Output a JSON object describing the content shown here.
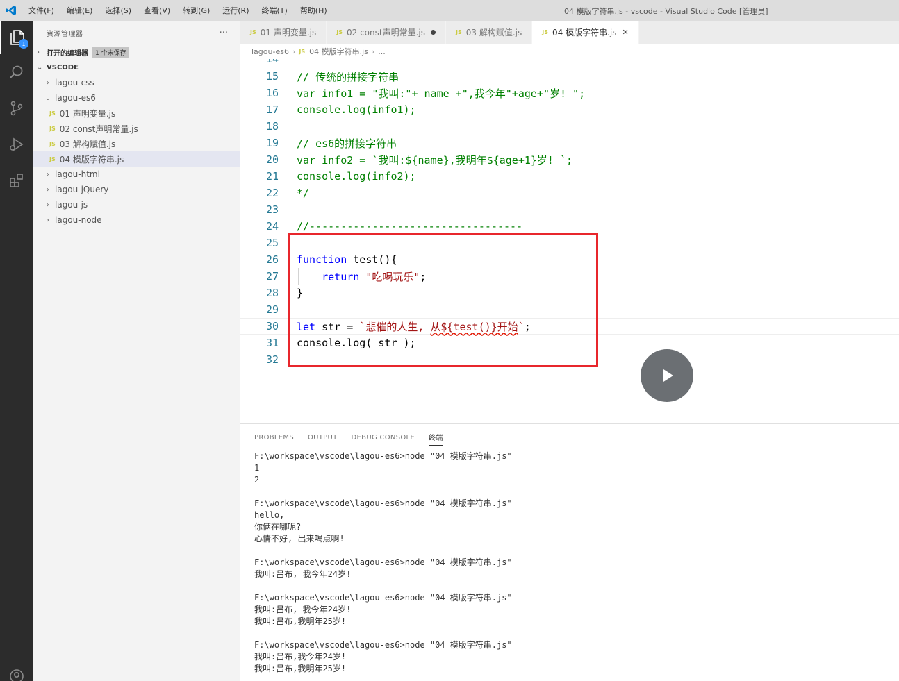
{
  "titlebar": {
    "menu": [
      "文件(F)",
      "编辑(E)",
      "选择(S)",
      "查看(V)",
      "转到(G)",
      "运行(R)",
      "终端(T)",
      "帮助(H)"
    ],
    "window_title": "04 模版字符串.js - vscode - Visual Studio Code [管理员]"
  },
  "activity": {
    "badge": "1"
  },
  "sidebar": {
    "title": "资源管理器",
    "more": "···",
    "open_editors_label": "打开的编辑器",
    "unsaved_badge": "1 个未保存",
    "workspace_label": "VSCODE",
    "items": [
      {
        "label": "lagou-css",
        "kind": "folder",
        "expanded": false
      },
      {
        "label": "lagou-es6",
        "kind": "folder",
        "expanded": true
      },
      {
        "label": "01 声明变量.js",
        "kind": "file"
      },
      {
        "label": "02 const声明常量.js",
        "kind": "file"
      },
      {
        "label": "03 解构赋值.js",
        "kind": "file"
      },
      {
        "label": "04 模版字符串.js",
        "kind": "file",
        "selected": true
      },
      {
        "label": "lagou-html",
        "kind": "folder",
        "expanded": false
      },
      {
        "label": "lagou-jQuery",
        "kind": "folder",
        "expanded": false
      },
      {
        "label": "lagou-js",
        "kind": "folder",
        "expanded": false
      },
      {
        "label": "lagou-node",
        "kind": "folder",
        "expanded": false
      }
    ],
    "js_badge": "JS"
  },
  "tabs": [
    {
      "label": "01 声明变量.js",
      "active": false,
      "dirty": false
    },
    {
      "label": "02 const声明常量.js",
      "active": false,
      "dirty": true
    },
    {
      "label": "03 解构赋值.js",
      "active": false,
      "dirty": false
    },
    {
      "label": "04 模版字符串.js",
      "active": true,
      "dirty": false
    }
  ],
  "tab_close": "✕",
  "breadcrumb": {
    "folder": "lagou-es6",
    "file": "04 模版字符串.js",
    "more": "..."
  },
  "editor": {
    "partial_line_number": "14",
    "lines": [
      {
        "n": "15",
        "text": "// 传统的拼接字符串"
      },
      {
        "n": "16",
        "text": "var info1 = \"我叫:\"+ name +\",我今年\"+age+\"岁! \";"
      },
      {
        "n": "17",
        "text": "console.log(info1);"
      },
      {
        "n": "18",
        "text": ""
      },
      {
        "n": "19",
        "text": "// es6的拼接字符串"
      },
      {
        "n": "20",
        "text": "var info2 = `我叫:${name},我明年${age+1}岁! `;"
      },
      {
        "n": "21",
        "text": "console.log(info2);"
      },
      {
        "n": "22",
        "text": "*/"
      },
      {
        "n": "23",
        "text": ""
      },
      {
        "n": "24",
        "text": "//----------------------------------"
      },
      {
        "n": "25",
        "text": ""
      },
      {
        "n": "26",
        "text": "function test(){"
      },
      {
        "n": "27",
        "text": "    return \"吃喝玩乐\";"
      },
      {
        "n": "28",
        "text": "}"
      },
      {
        "n": "29",
        "text": ""
      },
      {
        "n": "30",
        "text": "let str = `悲催的人生, 从${test()}开始`;"
      },
      {
        "n": "31",
        "text": "console.log( str );"
      },
      {
        "n": "32",
        "text": ""
      }
    ]
  },
  "panel": {
    "tabs": [
      "PROBLEMS",
      "OUTPUT",
      "DEBUG CONSOLE",
      "终端"
    ],
    "active_tab": "终端",
    "terminal": [
      "F:\\workspace\\vscode\\lagou-es6>node \"04 模版字符串.js\"",
      "1",
      "2",
      "",
      "F:\\workspace\\vscode\\lagou-es6>node \"04 模版字符串.js\"",
      "hello,",
      "你俩在哪呢?",
      "心情不好, 出来喝点啊!",
      "",
      "F:\\workspace\\vscode\\lagou-es6>node \"04 模版字符串.js\"",
      "我叫:吕布, 我今年24岁!",
      "",
      "F:\\workspace\\vscode\\lagou-es6>node \"04 模版字符串.js\"",
      "我叫:吕布, 我今年24岁!",
      "我叫:吕布,我明年25岁!",
      "",
      "F:\\workspace\\vscode\\lagou-es6>node \"04 模版字符串.js\"",
      "我叫:吕布,我今年24岁!",
      "我叫:吕布,我明年25岁!"
    ]
  },
  "colors": {
    "highlight_border": "#e8262c",
    "keyword": "#0000ff",
    "string": "#a31515",
    "comment": "#008000",
    "line_number": "#237893"
  }
}
